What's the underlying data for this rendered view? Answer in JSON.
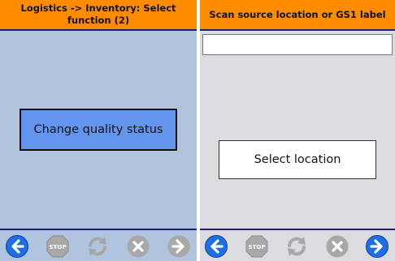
{
  "left_panel": {
    "header_title": "Logistics -> Inventory: Select function (2)",
    "action_button_label": "Change quality status",
    "footer_icons": [
      "back-arrow-icon",
      "stop-icon",
      "refresh-icon",
      "cancel-icon",
      "forward-arrow-icon"
    ]
  },
  "right_panel": {
    "header_title": "Scan source location or GS1 label",
    "scan_input_value": "",
    "action_button_label": "Select location",
    "footer_icons": [
      "back-arrow-icon",
      "stop-icon",
      "refresh-icon",
      "cancel-icon",
      "forward-arrow-icon"
    ]
  },
  "icon_text": {
    "stop": "STOP"
  },
  "colors": {
    "header_bg": "#ff8c00",
    "left_bg": "#b0c4de",
    "right_bg": "#dcdce0",
    "accent_button": "#6495ed",
    "nav_active": "#1e6ee6",
    "nav_disabled": "#a8a8a8",
    "divider": "#1e1e6e"
  }
}
